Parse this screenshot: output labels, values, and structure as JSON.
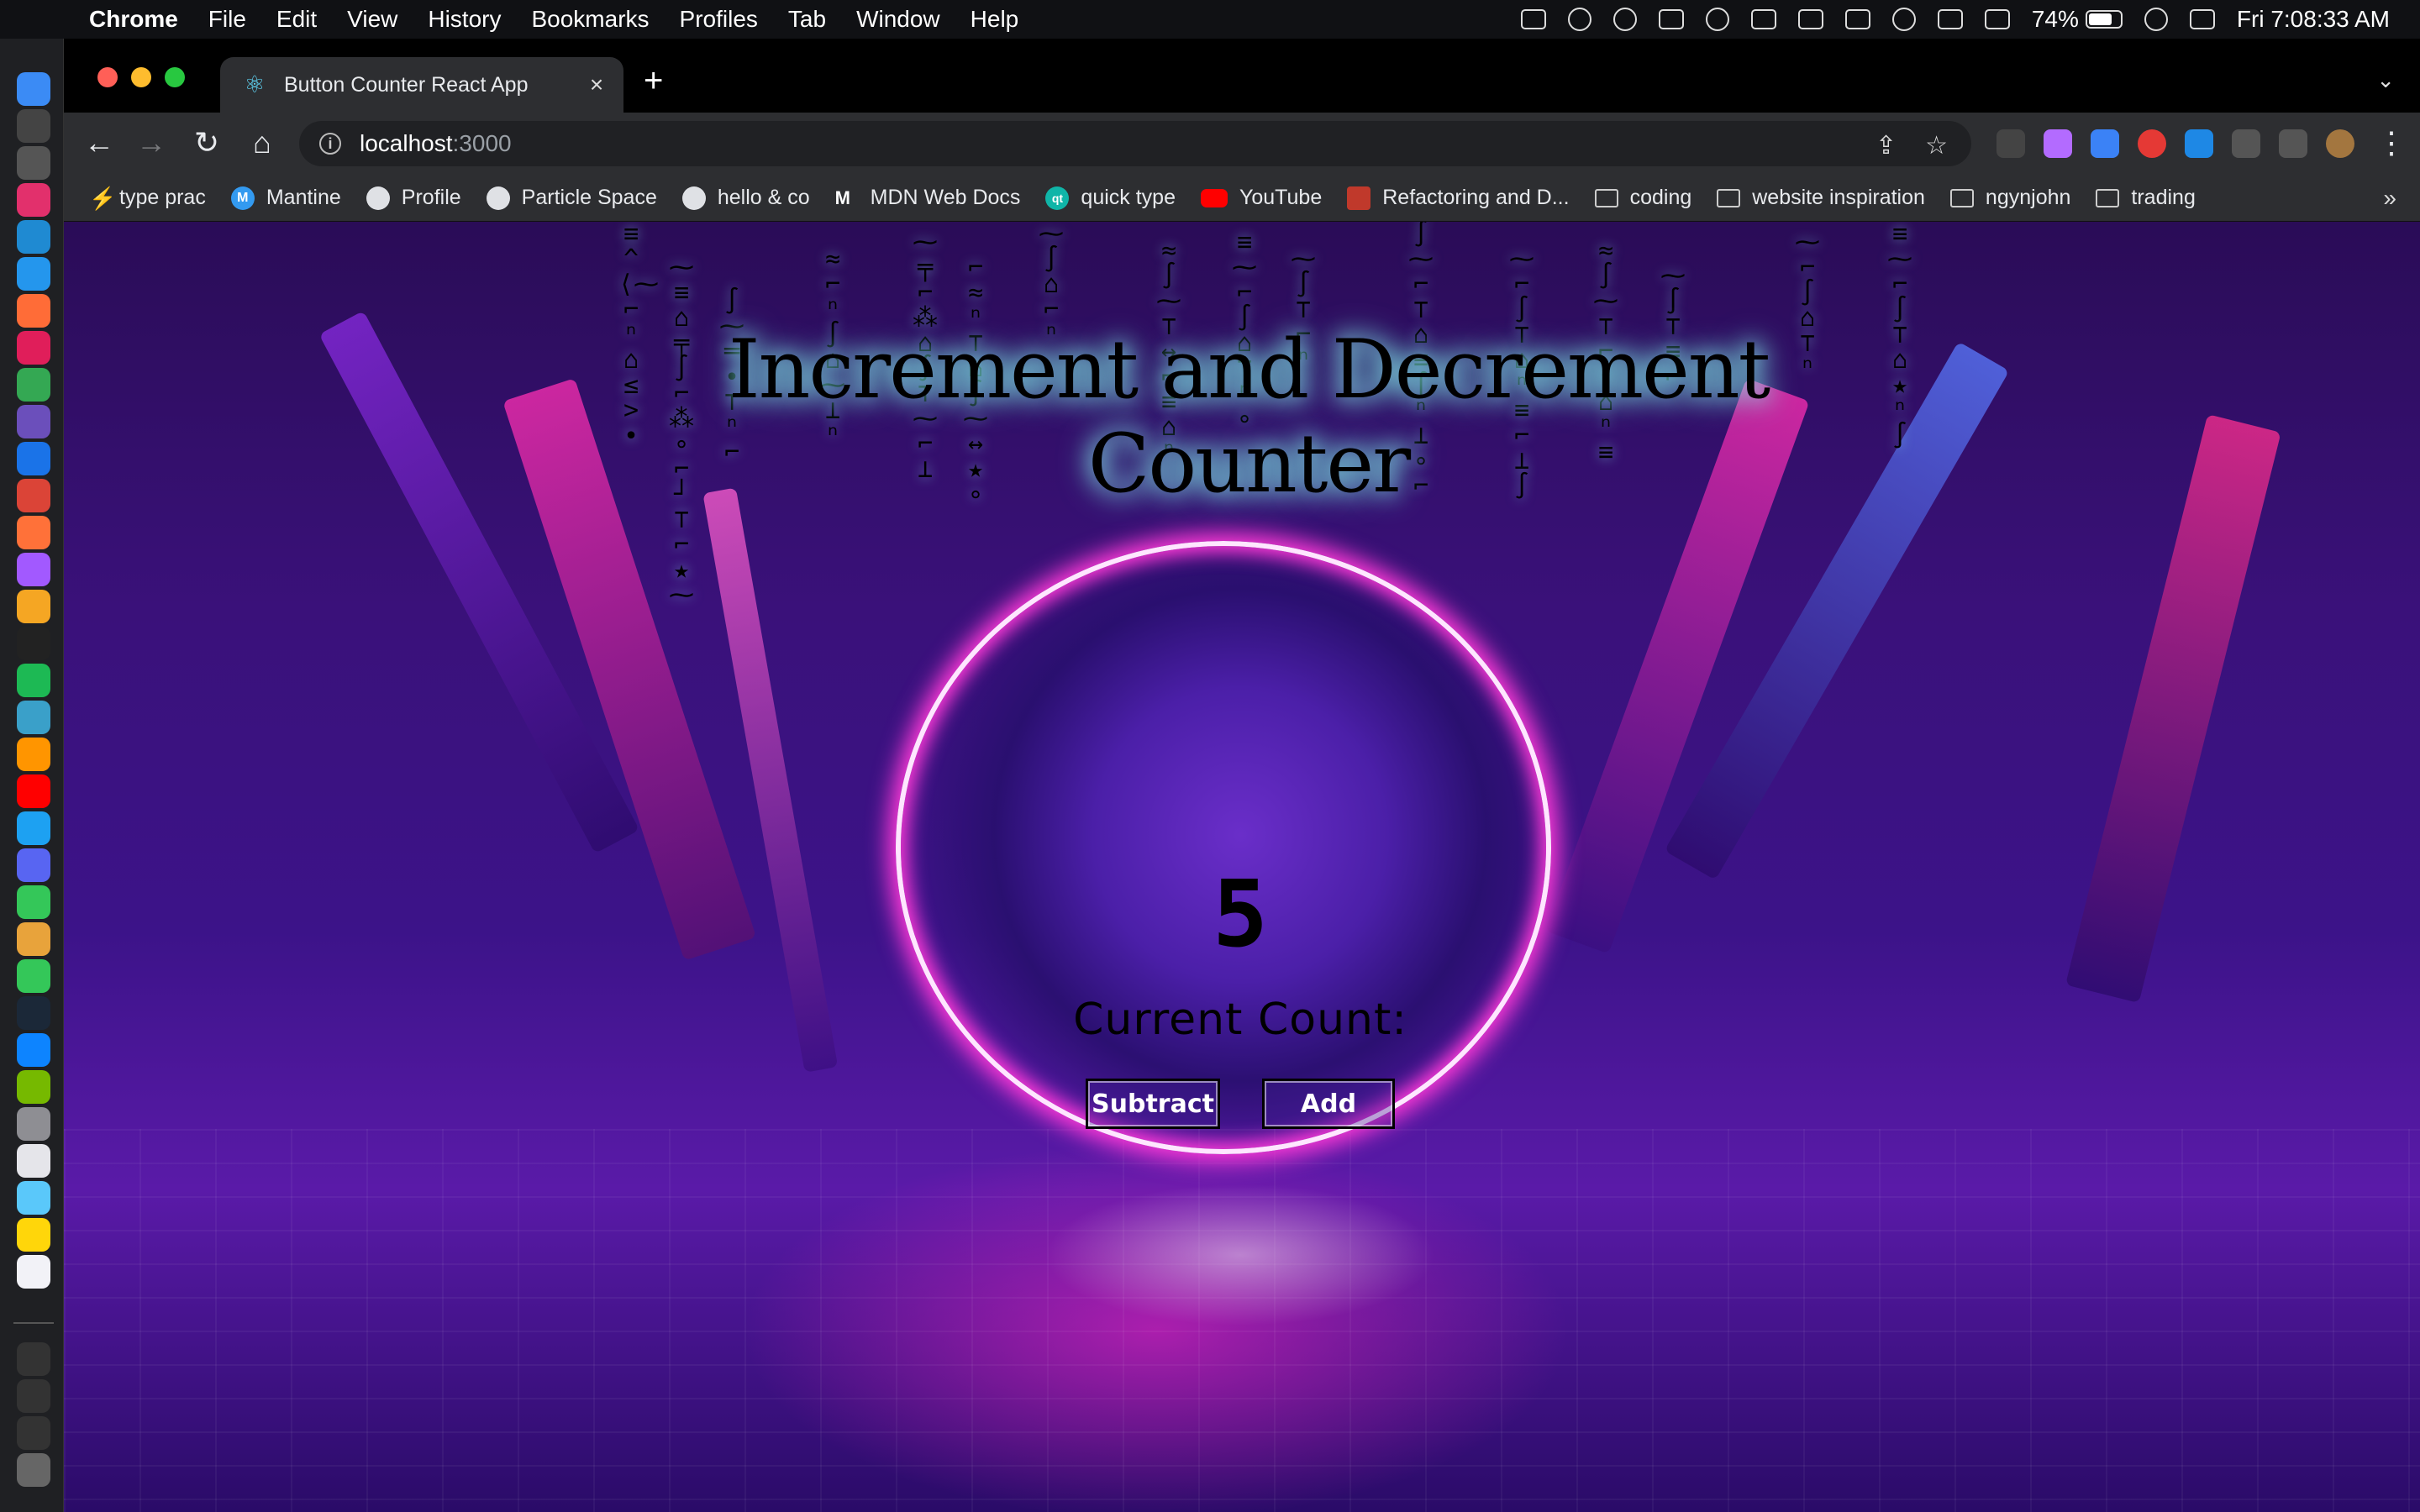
{
  "menubar": {
    "app": "Chrome",
    "items": [
      "File",
      "Edit",
      "View",
      "History",
      "Bookmarks",
      "Profiles",
      "Tab",
      "Window",
      "Help"
    ],
    "battery": "74%",
    "battery_level": 0.74,
    "clock": "Fri  7:08:33 AM"
  },
  "browser": {
    "tab_title": "Button Counter React App",
    "url_host": "localhost",
    "url_port": ":3000",
    "bookmarks": [
      {
        "label": "type prac",
        "icon": "bolt-icon"
      },
      {
        "label": "Mantine",
        "icon": "mantine-icon"
      },
      {
        "label": "Profile",
        "icon": "github-icon"
      },
      {
        "label": "Particle Space",
        "icon": "github-icon"
      },
      {
        "label": "hello & co",
        "icon": "github-icon"
      },
      {
        "label": "MDN Web Docs",
        "icon": "mdn-icon"
      },
      {
        "label": "quick type",
        "icon": "quicktype-icon"
      },
      {
        "label": "YouTube",
        "icon": "youtube-icon"
      },
      {
        "label": "Refactoring and D...",
        "icon": "refactoring-icon"
      },
      {
        "label": "coding",
        "icon": "folder-icon"
      },
      {
        "label": "website inspiration",
        "icon": "folder-icon"
      },
      {
        "label": "ngynjohn",
        "icon": "folder-icon"
      },
      {
        "label": "trading",
        "icon": "folder-icon"
      }
    ],
    "more": "»"
  },
  "app": {
    "heading": "Increment and Decrement Counter",
    "count": "5",
    "count_label": "Current Count:",
    "subtract_label": "Subtract",
    "add_label": "Add"
  },
  "colors": {
    "ring": "#ff3ad8",
    "heading_glow": "#9ff",
    "background": "#3c1389"
  }
}
